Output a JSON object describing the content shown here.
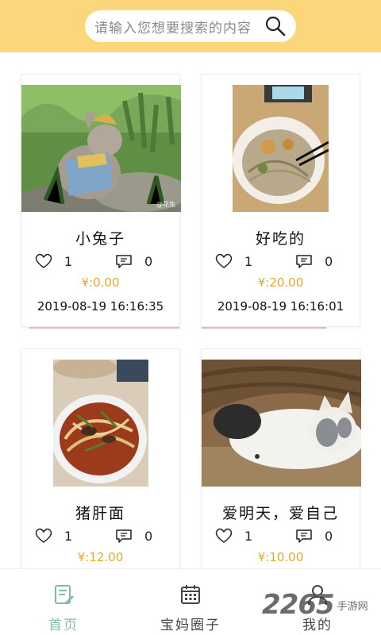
{
  "search": {
    "placeholder": "请输入您想要搜索的内容"
  },
  "cards": [
    {
      "title": "小兔子",
      "likes": "1",
      "comments": "0",
      "price": "¥:0.00",
      "time": "2019-08-19 16:16:35",
      "image": "rabbit-photo"
    },
    {
      "title": "好吃的",
      "likes": "1",
      "comments": "0",
      "price": "¥:20.00",
      "time": "2019-08-19 16:16:01",
      "image": "noodle-soup-photo"
    },
    {
      "title": "猪肝面",
      "likes": "1",
      "comments": "0",
      "price": "¥:12.00",
      "time": "",
      "image": "liver-noodles-photo"
    },
    {
      "title": "爱明天，爱自己",
      "likes": "1",
      "comments": "0",
      "price": "¥:10.00",
      "time": "",
      "image": "cat-photo"
    }
  ],
  "nav": [
    {
      "label": "首页",
      "icon": "home-note-icon",
      "active": true
    },
    {
      "label": "宝妈圈子",
      "icon": "calendar-icon",
      "active": false
    },
    {
      "label": "我的",
      "icon": "user-icon",
      "active": false
    }
  ],
  "watermark": {
    "number": "2265",
    "text": "手游网"
  },
  "colors": {
    "header": "#fbd67a",
    "price": "#e6a82a",
    "active_tab": "#7fbf9b",
    "inactive_tab": "#444444",
    "background_shape": "#eab1b6"
  }
}
